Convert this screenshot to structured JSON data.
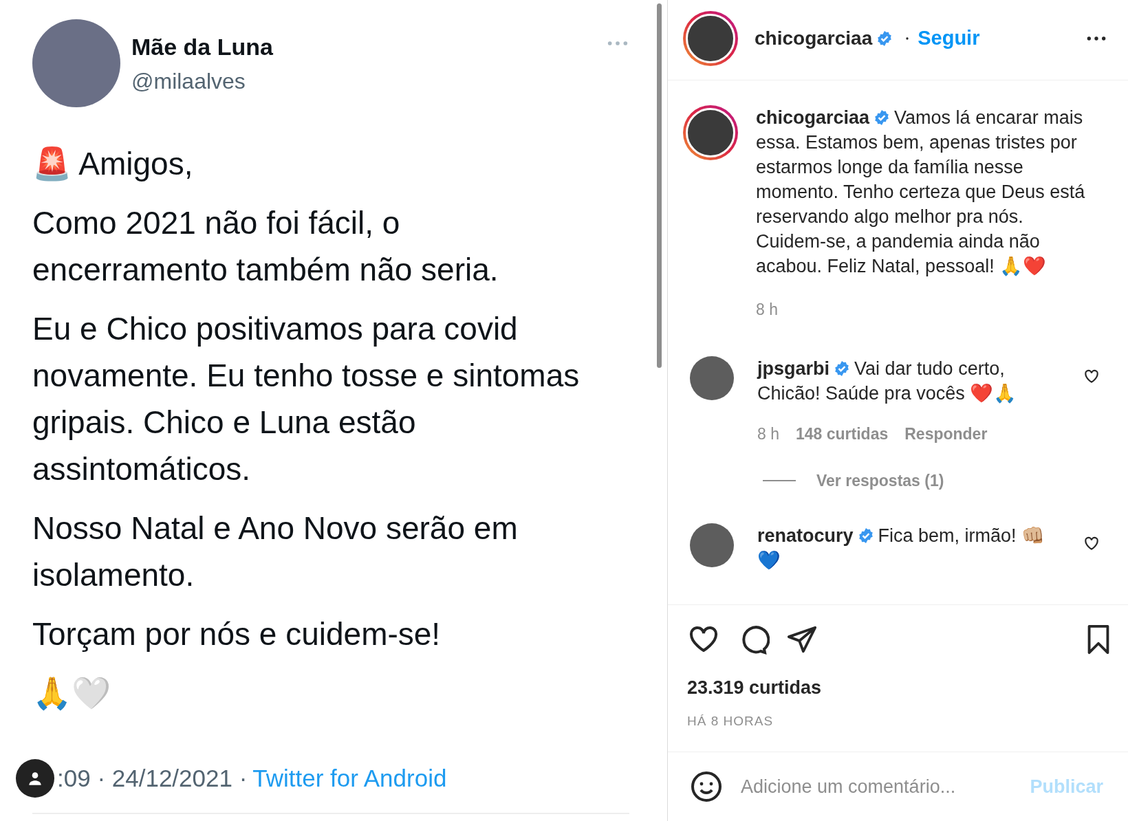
{
  "tweet": {
    "author": {
      "name": "Mãe da Luna",
      "handle": "@milaalves"
    },
    "paragraphs": [
      "🚨 Amigos,",
      "Como 2021 não foi fácil, o encerramento também não seria.",
      "Eu e Chico positivamos para covid novamente. Eu tenho tosse e sintomas gripais. Chico e Luna estão assintomáticos.",
      "Nosso Natal e Ano Novo serão em isolamento.",
      "Torçam por nós e cuidem-se!",
      "🙏🤍"
    ],
    "timestamp": ":09 · 24/12/2021 ·",
    "source": "Twitter for Android"
  },
  "instagram": {
    "header": {
      "username": "chicogarciaa",
      "verified": true,
      "follow": "Seguir"
    },
    "caption": {
      "username": "chicogarciaa",
      "verified": true,
      "text": "Vamos lá encarar mais essa. Estamos bem, apenas tristes por estarmos longe da família nesse momento. Tenho certeza que Deus está reservando algo melhor pra nós. Cuidem-se, a pandemia ainda não acabou. Feliz Natal, pessoal! 🙏❤️",
      "time": "8 h"
    },
    "comments": [
      {
        "username": "jpsgarbi",
        "verified": true,
        "text": "Vai dar tudo certo, Chicão! Saúde pra vocês ❤️🙏",
        "time": "8 h",
        "likes": "148 curtidas",
        "reply": "Responder",
        "view_replies": "Ver respostas (1)"
      },
      {
        "username": "renatocury",
        "verified": true,
        "text": "Fica bem, irmão! 👊🏼 💙"
      }
    ],
    "likes": "23.319 curtidas",
    "posted": "HÁ 8 HORAS",
    "comment_box": {
      "placeholder": "Adicione um comentário...",
      "submit": "Publicar"
    }
  }
}
